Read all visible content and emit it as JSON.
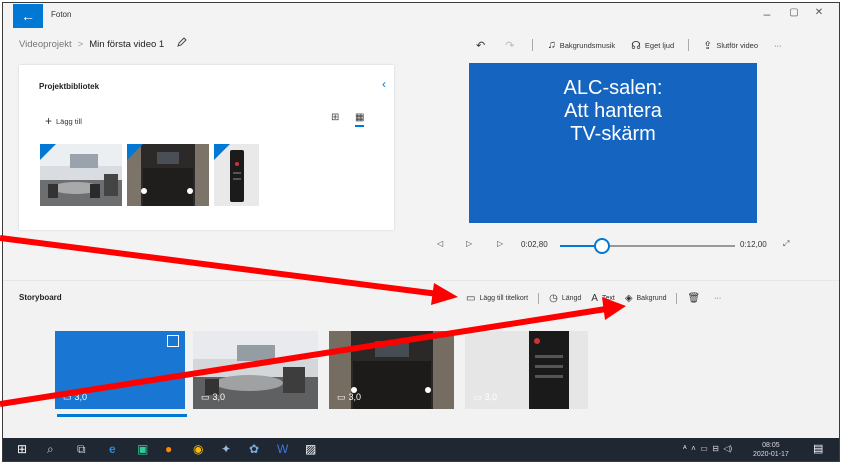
{
  "titlebar": {
    "app_name": "Foton",
    "back_glyph": "←",
    "minimize_glyph": "–",
    "restore_glyph": "▢",
    "close_glyph": "✕"
  },
  "breadcrumb": {
    "root": "Videoprojekt",
    "separator": ">",
    "current": "Min första video 1"
  },
  "toolbar": {
    "undo_glyph": "↶",
    "redo_glyph": "↷",
    "music_label": "Bakgrundsmusik",
    "audio_label": "Eget ljud",
    "finish_label": "Slutför video",
    "more_glyph": "···"
  },
  "library": {
    "title": "Projektbibliotek",
    "add_label": "Lägg till",
    "collapse_glyph": "‹"
  },
  "preview": {
    "lines": [
      "ALC-salen:",
      "Att hantera",
      "TV-skärm"
    ],
    "bg_color": "#1565c0"
  },
  "playback": {
    "current_time": "0:02,80",
    "total_time": "0:12,00",
    "progress": 0.233
  },
  "storyboard": {
    "title": "Storyboard",
    "add_title_card_label": "Lägg till titelkort",
    "duration_label": "Längd",
    "text_label": "Text",
    "background_label": "Bakgrund",
    "more_glyph": "···",
    "cards": [
      {
        "duration": "3,0"
      },
      {
        "duration": "3,0"
      },
      {
        "duration": "3,0"
      },
      {
        "duration": "3,0"
      }
    ]
  },
  "taskbar": {
    "time": "08:05",
    "date": "2020-01-17"
  },
  "colors": {
    "accent": "#0078d4",
    "annotation_arrow": "#ff0000"
  }
}
